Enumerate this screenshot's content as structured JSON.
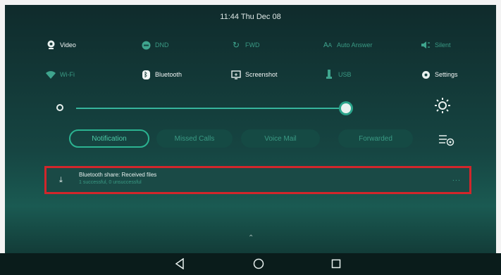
{
  "status_bar": {
    "clock": "11:44 Thu Dec 08"
  },
  "quick_settings": {
    "row1": [
      {
        "id": "video",
        "label": "Video",
        "icon": "video-icon",
        "state": "on"
      },
      {
        "id": "dnd",
        "label": "DND",
        "icon": "dnd-icon",
        "state": "off"
      },
      {
        "id": "fwd",
        "label": "FWD",
        "icon": "forward-icon",
        "state": "off"
      },
      {
        "id": "auto-answer",
        "label": "Auto Answer",
        "icon": "auto-answer-icon",
        "state": "off"
      },
      {
        "id": "silent",
        "label": "Silent",
        "icon": "speaker-icon",
        "state": "off"
      }
    ],
    "row2": [
      {
        "id": "wifi",
        "label": "Wi-Fi",
        "icon": "wifi-icon",
        "state": "off"
      },
      {
        "id": "bluetooth",
        "label": "Bluetooth",
        "icon": "bluetooth-icon",
        "state": "on"
      },
      {
        "id": "screenshot",
        "label": "Screenshot",
        "icon": "screenshot-icon",
        "state": "on"
      },
      {
        "id": "usb",
        "label": "USB",
        "icon": "usb-icon",
        "state": "off"
      },
      {
        "id": "settings",
        "label": "Settings",
        "icon": "gear-icon",
        "state": "on"
      }
    ]
  },
  "brightness": {
    "level": 0.95
  },
  "tabs": [
    {
      "label": "Notification",
      "active": true
    },
    {
      "label": "Missed Calls",
      "active": false
    },
    {
      "label": "Voice Mail",
      "active": false
    },
    {
      "label": "Forwarded",
      "active": false
    }
  ],
  "notification": {
    "title": "Bluetooth share: Received files",
    "subtitle": "1 successful, 0 unsuccessful",
    "more": "..."
  },
  "navigation": {
    "back_icon": "back-icon",
    "home_icon": "home-icon",
    "recents_icon": "recents-icon"
  },
  "colors": {
    "accent": "#2bb391",
    "highlight_border": "#d2262b"
  }
}
